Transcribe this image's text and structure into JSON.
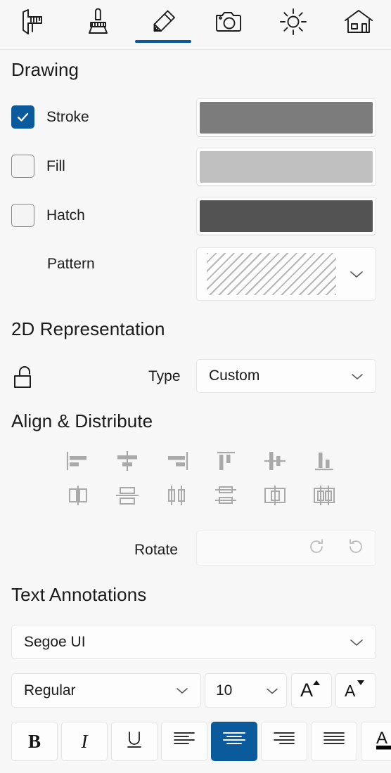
{
  "tabs": [
    {
      "id": "measure",
      "icon": "caliper-icon",
      "label": "Measure",
      "active": false
    },
    {
      "id": "stamp",
      "icon": "stamp-icon",
      "label": "Stamp",
      "active": false
    },
    {
      "id": "markup",
      "icon": "pencil-icon",
      "label": "Markup",
      "active": true
    },
    {
      "id": "capture",
      "icon": "camera-icon",
      "label": "Capture",
      "active": false
    },
    {
      "id": "lighting",
      "icon": "sun-icon",
      "label": "Lighting",
      "active": false
    },
    {
      "id": "home",
      "icon": "house-icon",
      "label": "Home",
      "active": false
    }
  ],
  "colors": {
    "accent": "#0a5a9c",
    "stroke_swatch": "#7c7c7c",
    "fill_swatch": "#c0c0c0",
    "hatch_swatch": "#535353",
    "panel_bg": "#f7f7f7",
    "control_bg": "#fdfdfd",
    "disabled": "#a9a9a9"
  },
  "drawing": {
    "title": "Drawing",
    "stroke": {
      "label": "Stroke",
      "checked": true,
      "color": "#7c7c7c"
    },
    "fill": {
      "label": "Fill",
      "checked": false,
      "color": "#c0c0c0"
    },
    "hatch": {
      "label": "Hatch",
      "checked": false,
      "color": "#535353"
    },
    "pattern": {
      "label": "Pattern",
      "value": "diagonal-lines"
    }
  },
  "representation": {
    "title": "2D Representation",
    "lock": {
      "icon": "unlock-icon",
      "state": "unlocked"
    },
    "type": {
      "label": "Type",
      "value": "Custom",
      "options": [
        "Custom"
      ]
    }
  },
  "align": {
    "title": "Align & Distribute",
    "buttons": [
      {
        "id": "align-left",
        "icon": "align-left-icon"
      },
      {
        "id": "align-center-horizontal",
        "icon": "align-center-horizontal-icon"
      },
      {
        "id": "align-right",
        "icon": "align-right-icon"
      },
      {
        "id": "align-top",
        "icon": "align-top-icon"
      },
      {
        "id": "align-middle-vertical",
        "icon": "align-middle-vertical-icon"
      },
      {
        "id": "align-bottom",
        "icon": "align-bottom-icon"
      },
      {
        "id": "distribute-horizontal-centers",
        "icon": "distribute-horizontal-centers-icon"
      },
      {
        "id": "distribute-vertical-centers",
        "icon": "distribute-vertical-centers-icon"
      },
      {
        "id": "distribute-horizontal-edges",
        "icon": "distribute-horizontal-edges-icon"
      },
      {
        "id": "distribute-vertical-edges",
        "icon": "distribute-vertical-edges-icon"
      },
      {
        "id": "distribute-horizontal-gaps",
        "icon": "distribute-horizontal-gaps-icon"
      },
      {
        "id": "distribute-vertical-gaps",
        "icon": "distribute-vertical-gaps-icon"
      }
    ],
    "rotate": {
      "label": "Rotate",
      "clockwise_icon": "rotate-clockwise-icon",
      "counterclockwise_icon": "rotate-counterclockwise-icon",
      "enabled": false
    }
  },
  "text_annotations": {
    "title": "Text Annotations",
    "font": {
      "value": "Segoe UI",
      "options": [
        "Segoe UI"
      ]
    },
    "style": {
      "value": "Regular",
      "options": [
        "Regular"
      ]
    },
    "size": {
      "value": "10",
      "options": [
        "10"
      ]
    },
    "grow_font": {
      "label": "A",
      "icon": "increase-font-size-icon"
    },
    "shrink_font": {
      "label": "A",
      "icon": "decrease-font-size-icon"
    },
    "format_buttons": [
      {
        "id": "bold",
        "label": "B",
        "icon": "bold-icon",
        "selected": false
      },
      {
        "id": "italic",
        "label": "I",
        "icon": "italic-icon",
        "selected": false
      },
      {
        "id": "underline",
        "label": "U",
        "icon": "underline-icon",
        "selected": false
      },
      {
        "id": "align-left",
        "label": "",
        "icon": "text-align-left-icon",
        "selected": false
      },
      {
        "id": "align-center",
        "label": "",
        "icon": "text-align-center-icon",
        "selected": true
      },
      {
        "id": "align-right",
        "label": "",
        "icon": "text-align-right-icon",
        "selected": false
      },
      {
        "id": "align-justify",
        "label": "",
        "icon": "text-align-justify-icon",
        "selected": false
      },
      {
        "id": "font-color",
        "label": "A",
        "icon": "font-color-icon",
        "selected": false
      }
    ]
  }
}
